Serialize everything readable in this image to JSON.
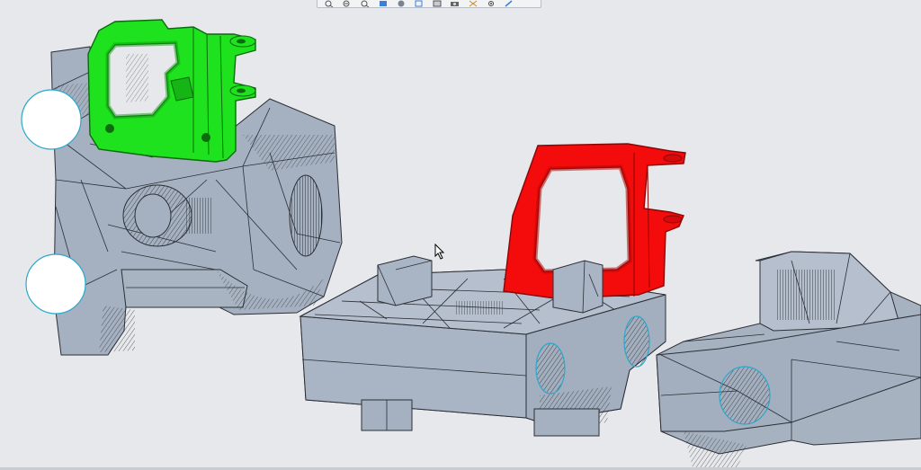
{
  "toolbar": {
    "tools": [
      {
        "id": "zoom-in",
        "icon": "zoom-in-icon"
      },
      {
        "id": "zoom-out",
        "icon": "zoom-out-icon"
      },
      {
        "id": "zoom-window",
        "icon": "zoom-window-icon"
      },
      {
        "id": "refit",
        "icon": "refit-icon"
      },
      {
        "id": "orient",
        "icon": "orient-icon"
      },
      {
        "id": "saved-views",
        "icon": "saved-views-icon"
      },
      {
        "id": "display-style",
        "icon": "display-style-icon"
      },
      {
        "id": "camera",
        "icon": "camera-icon"
      },
      {
        "id": "datum-display",
        "icon": "datum-display-icon"
      },
      {
        "id": "spin-center",
        "icon": "spin-center-icon"
      },
      {
        "id": "annotation",
        "icon": "annotation-icon"
      }
    ]
  },
  "model": {
    "highlight_colors": {
      "green_part": "#1fe21f",
      "red_part": "#f40c0c",
      "mesh_gray": "#a7b2c1",
      "mesh_edge": "#2b2f36",
      "datum_circle": "#29a9cc"
    }
  }
}
